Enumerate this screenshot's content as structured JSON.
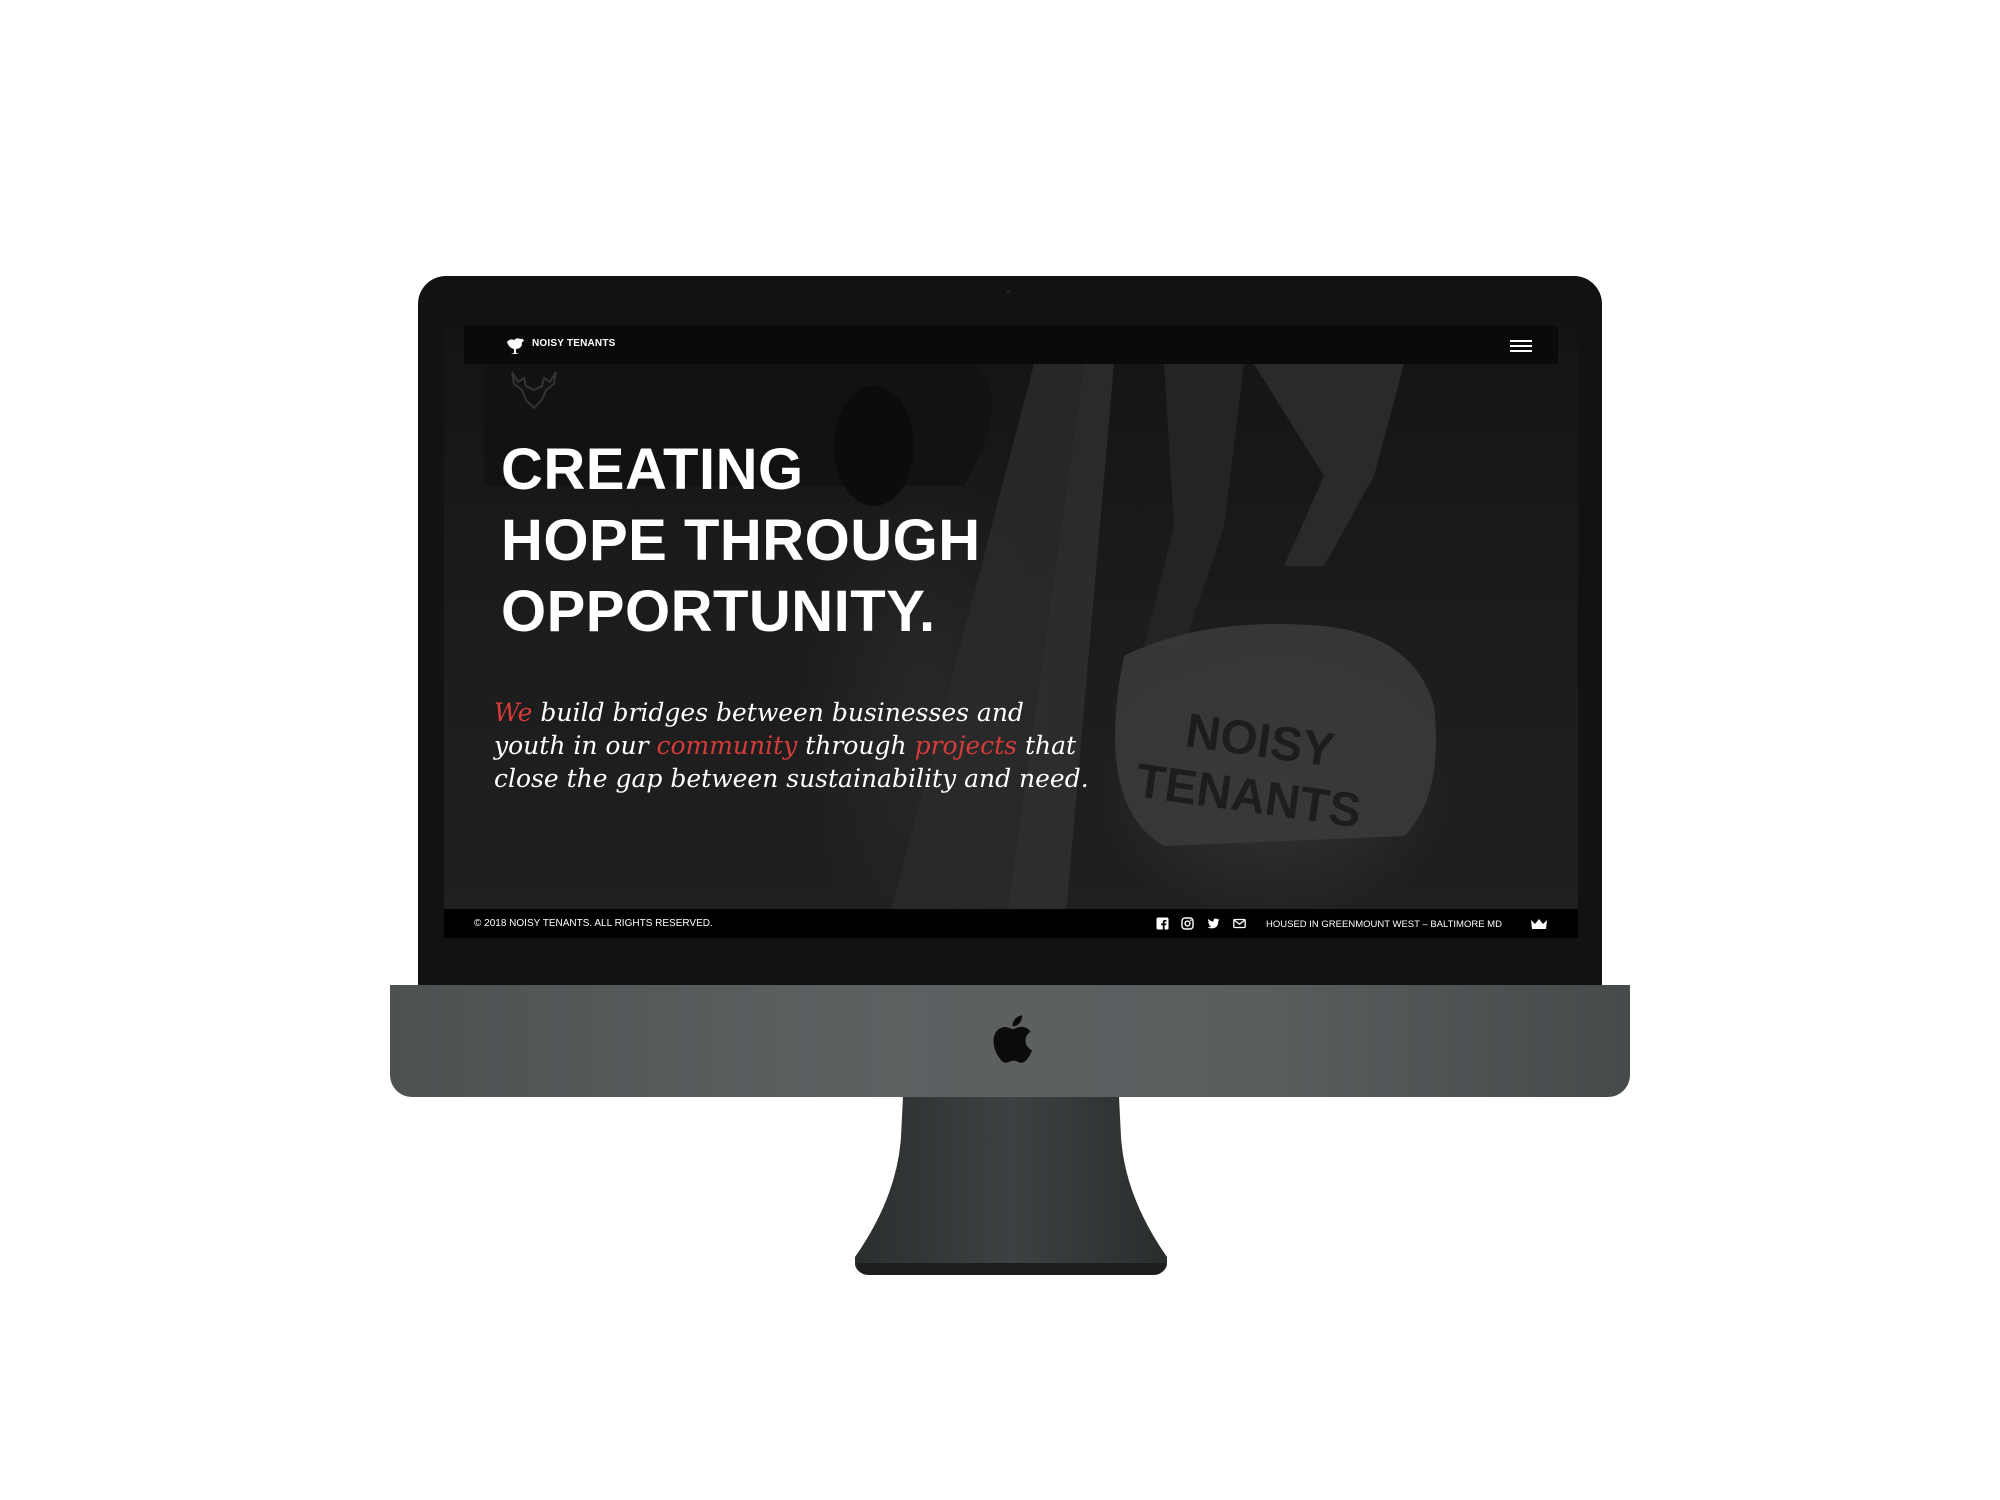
{
  "header": {
    "brand_name": "NOISY TENANTS",
    "menu_icon": "hamburger-menu-icon"
  },
  "hero": {
    "headline_lines": [
      "CREATING",
      "HOPE THROUGH",
      "OPPORTUNITY."
    ],
    "tagline": {
      "w1": "We",
      "t1": " build bridges between businesses and youth in our ",
      "w2": "community",
      "t2": " through ",
      "w3": "projects",
      "t3": " that close the gap between sustainability and need."
    }
  },
  "footer": {
    "copyright": "© 2018 NOISY TENANTS. ALL RIGHTS RESERVED.",
    "social_icons": [
      "facebook-icon",
      "instagram-icon",
      "twitter-icon",
      "email-icon"
    ],
    "location": "HOUSED IN GREENMOUNT WEST – BALTIMORE MD",
    "crown_icon": "crown-icon"
  },
  "colors": {
    "accent": "#d63b3b",
    "background": "#1a1a1a",
    "text": "#ffffff"
  }
}
